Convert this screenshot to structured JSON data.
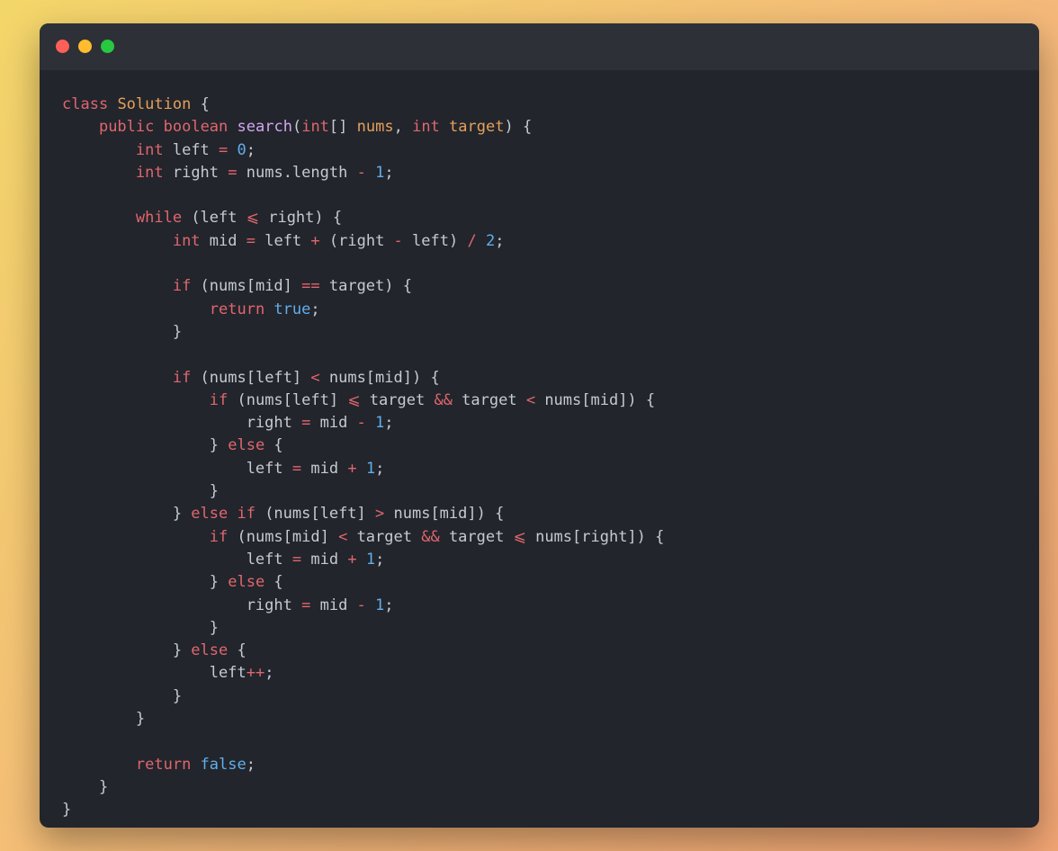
{
  "window": {
    "controls": [
      "close",
      "minimize",
      "maximize"
    ],
    "colors": {
      "close": "#fe5f57",
      "minimize": "#febc2e",
      "maximize": "#28c840",
      "background": "#22252b",
      "titlebar": "#2d3037"
    }
  },
  "editor": {
    "language": "java",
    "lines": [
      [
        [
          "kw",
          "class"
        ],
        [
          "tx",
          " "
        ],
        [
          "ty",
          "Solution"
        ],
        [
          "tx",
          " {"
        ]
      ],
      [
        [
          "tx",
          "    "
        ],
        [
          "kw",
          "public"
        ],
        [
          "tx",
          " "
        ],
        [
          "kw",
          "boolean"
        ],
        [
          "tx",
          " "
        ],
        [
          "fn",
          "search"
        ],
        [
          "tx",
          "("
        ],
        [
          "kw",
          "int"
        ],
        [
          "tx",
          "[] "
        ],
        [
          "pa",
          "nums"
        ],
        [
          "tx",
          ", "
        ],
        [
          "kw",
          "int"
        ],
        [
          "tx",
          " "
        ],
        [
          "pa",
          "target"
        ],
        [
          "tx",
          ") {"
        ]
      ],
      [
        [
          "tx",
          "        "
        ],
        [
          "kw",
          "int"
        ],
        [
          "tx",
          " left "
        ],
        [
          "op",
          "="
        ],
        [
          "tx",
          " "
        ],
        [
          "nm",
          "0"
        ],
        [
          "tx",
          ";"
        ]
      ],
      [
        [
          "tx",
          "        "
        ],
        [
          "kw",
          "int"
        ],
        [
          "tx",
          " right "
        ],
        [
          "op",
          "="
        ],
        [
          "tx",
          " nums.length "
        ],
        [
          "op",
          "-"
        ],
        [
          "tx",
          " "
        ],
        [
          "nm",
          "1"
        ],
        [
          "tx",
          ";"
        ]
      ],
      [],
      [
        [
          "tx",
          "        "
        ],
        [
          "kw",
          "while"
        ],
        [
          "tx",
          " (left "
        ],
        [
          "op",
          "⩽"
        ],
        [
          "tx",
          " right) {"
        ]
      ],
      [
        [
          "tx",
          "            "
        ],
        [
          "kw",
          "int"
        ],
        [
          "tx",
          " mid "
        ],
        [
          "op",
          "="
        ],
        [
          "tx",
          " left "
        ],
        [
          "op",
          "+"
        ],
        [
          "tx",
          " (right "
        ],
        [
          "op",
          "-"
        ],
        [
          "tx",
          " left) "
        ],
        [
          "op",
          "/"
        ],
        [
          "tx",
          " "
        ],
        [
          "nm",
          "2"
        ],
        [
          "tx",
          ";"
        ]
      ],
      [],
      [
        [
          "tx",
          "            "
        ],
        [
          "kw",
          "if"
        ],
        [
          "tx",
          " (nums[mid] "
        ],
        [
          "op",
          "=="
        ],
        [
          "tx",
          " target) {"
        ]
      ],
      [
        [
          "tx",
          "                "
        ],
        [
          "kw",
          "return"
        ],
        [
          "tx",
          " "
        ],
        [
          "nm",
          "true"
        ],
        [
          "tx",
          ";"
        ]
      ],
      [
        [
          "tx",
          "            }"
        ]
      ],
      [],
      [
        [
          "tx",
          "            "
        ],
        [
          "kw",
          "if"
        ],
        [
          "tx",
          " (nums[left] "
        ],
        [
          "op",
          "<"
        ],
        [
          "tx",
          " nums[mid]) {"
        ]
      ],
      [
        [
          "tx",
          "                "
        ],
        [
          "kw",
          "if"
        ],
        [
          "tx",
          " (nums[left] "
        ],
        [
          "op",
          "⩽"
        ],
        [
          "tx",
          " target "
        ],
        [
          "op",
          "&&"
        ],
        [
          "tx",
          " target "
        ],
        [
          "op",
          "<"
        ],
        [
          "tx",
          " nums[mid]) {"
        ]
      ],
      [
        [
          "tx",
          "                    right "
        ],
        [
          "op",
          "="
        ],
        [
          "tx",
          " mid "
        ],
        [
          "op",
          "-"
        ],
        [
          "tx",
          " "
        ],
        [
          "nm",
          "1"
        ],
        [
          "tx",
          ";"
        ]
      ],
      [
        [
          "tx",
          "                } "
        ],
        [
          "kw",
          "else"
        ],
        [
          "tx",
          " {"
        ]
      ],
      [
        [
          "tx",
          "                    left "
        ],
        [
          "op",
          "="
        ],
        [
          "tx",
          " mid "
        ],
        [
          "op",
          "+"
        ],
        [
          "tx",
          " "
        ],
        [
          "nm",
          "1"
        ],
        [
          "tx",
          ";"
        ]
      ],
      [
        [
          "tx",
          "                }"
        ]
      ],
      [
        [
          "tx",
          "            } "
        ],
        [
          "kw",
          "else if"
        ],
        [
          "tx",
          " (nums[left] "
        ],
        [
          "op",
          ">"
        ],
        [
          "tx",
          " nums[mid]) {"
        ]
      ],
      [
        [
          "tx",
          "                "
        ],
        [
          "kw",
          "if"
        ],
        [
          "tx",
          " (nums[mid] "
        ],
        [
          "op",
          "<"
        ],
        [
          "tx",
          " target "
        ],
        [
          "op",
          "&&"
        ],
        [
          "tx",
          " target "
        ],
        [
          "op",
          "⩽"
        ],
        [
          "tx",
          " nums[right]) {"
        ]
      ],
      [
        [
          "tx",
          "                    left "
        ],
        [
          "op",
          "="
        ],
        [
          "tx",
          " mid "
        ],
        [
          "op",
          "+"
        ],
        [
          "tx",
          " "
        ],
        [
          "nm",
          "1"
        ],
        [
          "tx",
          ";"
        ]
      ],
      [
        [
          "tx",
          "                } "
        ],
        [
          "kw",
          "else"
        ],
        [
          "tx",
          " {"
        ]
      ],
      [
        [
          "tx",
          "                    right "
        ],
        [
          "op",
          "="
        ],
        [
          "tx",
          " mid "
        ],
        [
          "op",
          "-"
        ],
        [
          "tx",
          " "
        ],
        [
          "nm",
          "1"
        ],
        [
          "tx",
          ";"
        ]
      ],
      [
        [
          "tx",
          "                }"
        ]
      ],
      [
        [
          "tx",
          "            } "
        ],
        [
          "kw",
          "else"
        ],
        [
          "tx",
          " {"
        ]
      ],
      [
        [
          "tx",
          "                left"
        ],
        [
          "op",
          "++"
        ],
        [
          "tx",
          ";"
        ]
      ],
      [
        [
          "tx",
          "            }"
        ]
      ],
      [
        [
          "tx",
          "        }"
        ]
      ],
      [],
      [
        [
          "tx",
          "        "
        ],
        [
          "kw",
          "return"
        ],
        [
          "tx",
          " "
        ],
        [
          "nm",
          "false"
        ],
        [
          "tx",
          ";"
        ]
      ],
      [
        [
          "tx",
          "    }"
        ]
      ],
      [
        [
          "tx",
          "}"
        ]
      ]
    ]
  }
}
